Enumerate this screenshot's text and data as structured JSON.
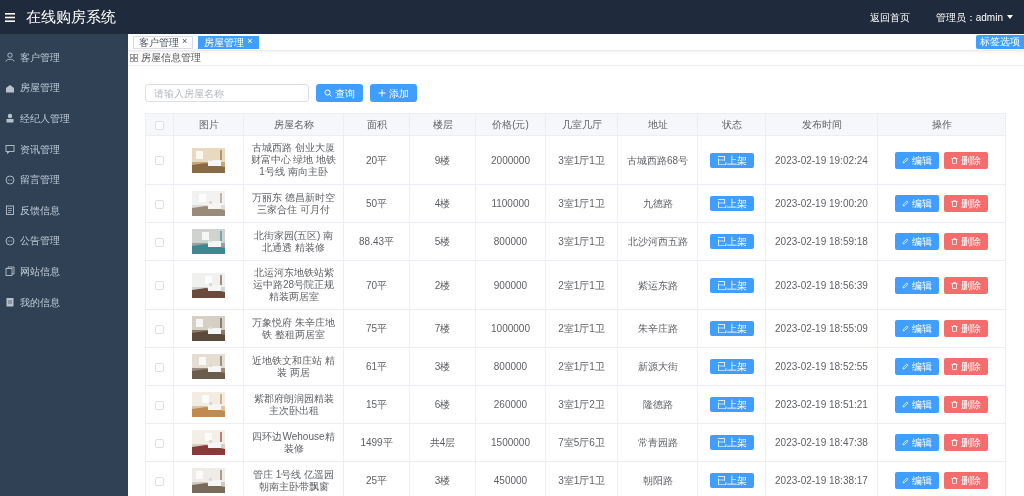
{
  "header": {
    "title": "在线购房系统",
    "links": [
      "返回首页"
    ],
    "user": "管理员：admin"
  },
  "sidebar": {
    "items": [
      {
        "label": "客户管理",
        "kind": "user"
      },
      {
        "label": "房屋管理",
        "kind": "house"
      },
      {
        "label": "经纪人管理",
        "kind": "person"
      },
      {
        "label": "资讯管理",
        "kind": "chat"
      },
      {
        "label": "留言管理",
        "kind": "bubble"
      },
      {
        "label": "反馈信息",
        "kind": "doc"
      },
      {
        "label": "公告管理",
        "kind": "bubble"
      },
      {
        "label": "网站信息",
        "kind": "copy"
      },
      {
        "label": "我的信息",
        "kind": "card"
      }
    ]
  },
  "tabs": [
    {
      "label": "客户管理",
      "close": "×",
      "selected": false
    },
    {
      "label": "房屋管理",
      "close": "×",
      "selected": true
    }
  ],
  "tab_options": "标签选项",
  "breadcrumb": "房屋信息管理",
  "search": {
    "placeholder": "请输入房屋名称",
    "buttons": [
      "查询",
      "添加"
    ]
  },
  "table": {
    "columns": [
      "图片",
      "房屋名称",
      "面积",
      "楼层",
      "价格(元)",
      "几室几厅",
      "地址",
      "状态",
      "发布时间",
      "操作"
    ],
    "header_checked": false,
    "rows": [
      {
        "checked": false,
        "name": "古城西路 创业大厦财富中心 绿地 地铁1号线 南向主卧",
        "area": "20平",
        "floor": "9楼",
        "price": "2000000",
        "rooms": "3室1厅1卫",
        "address": "古城西路68号",
        "status": "已上架",
        "time": "2023-02-19 19:02:24",
        "actions": [
          "编辑",
          "删除"
        ]
      },
      {
        "checked": false,
        "name": "万丽东 德昌新时空三家合住 可月付",
        "area": "50平",
        "floor": "4楼",
        "price": "1100000",
        "rooms": "3室1厅1卫",
        "address": "九德路",
        "status": "已上架",
        "time": "2023-02-19 19:00:20",
        "actions": [
          "编辑",
          "删除"
        ]
      },
      {
        "checked": false,
        "name": "北街家园(五区) 南北通透 精装修",
        "area": "88.43平",
        "floor": "5楼",
        "price": "800000",
        "rooms": "3室1厅1卫",
        "address": "北沙河西五路",
        "status": "已上架",
        "time": "2023-02-19 18:59:18",
        "actions": [
          "编辑",
          "删除"
        ]
      },
      {
        "checked": false,
        "name": "北运河东地铁站紫运中路28号院正规精装两居室",
        "area": "70平",
        "floor": "2楼",
        "price": "900000",
        "rooms": "2室1厅1卫",
        "address": "紫运东路",
        "status": "已上架",
        "time": "2023-02-19 18:56:39",
        "actions": [
          "编辑",
          "删除"
        ]
      },
      {
        "checked": false,
        "name": "万象悦府 朱辛庄地铁 整租两居室",
        "area": "75平",
        "floor": "7楼",
        "price": "1000000",
        "rooms": "2室1厅1卫",
        "address": "朱辛庄路",
        "status": "已上架",
        "time": "2023-02-19 18:55:09",
        "actions": [
          "编辑",
          "删除"
        ]
      },
      {
        "checked": false,
        "name": "近地铁文和庄站 精装 两居",
        "area": "61平",
        "floor": "3楼",
        "price": "800000",
        "rooms": "2室1厅1卫",
        "address": "新源大街",
        "status": "已上架",
        "time": "2023-02-19 18:52:55",
        "actions": [
          "编辑",
          "删除"
        ]
      },
      {
        "checked": false,
        "name": "紫郡府朗润园精装主次卧出租",
        "area": "15平",
        "floor": "6楼",
        "price": "260000",
        "rooms": "3室1厅2卫",
        "address": "隆德路",
        "status": "已上架",
        "time": "2023-02-19 18:51:21",
        "actions": [
          "编辑",
          "删除"
        ]
      },
      {
        "checked": false,
        "name": "四环边Wehouse精装修",
        "area": "1499平",
        "floor": "共4层",
        "price": "1500000",
        "rooms": "7室5厅6卫",
        "address": "常青园路",
        "status": "已上架",
        "time": "2023-02-19 18:47:38",
        "actions": [
          "编辑",
          "删除"
        ]
      },
      {
        "checked": false,
        "name": "管庄 1号线 亿遥园朝南主卧带飘窗",
        "area": "25平",
        "floor": "3楼",
        "price": "450000",
        "rooms": "3室1厅1卫",
        "address": "朝阳路",
        "status": "已上架",
        "time": "2023-02-19 18:38:17",
        "actions": [
          "编辑",
          "删除"
        ]
      }
    ]
  }
}
